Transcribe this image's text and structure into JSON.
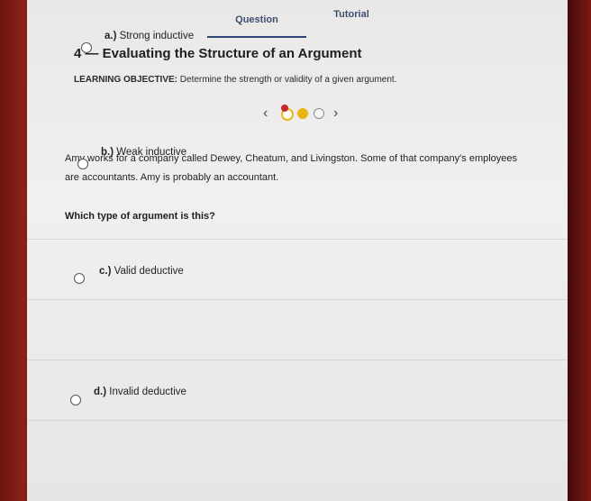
{
  "tabs": {
    "question": "Question",
    "tutorial": "Tutorial"
  },
  "lesson": {
    "title": "4 — Evaluating the Structure of an Argument",
    "objective_label": "LEARNING OBJECTIVE:",
    "objective_text": "Determine the strength or validity of a given argument."
  },
  "progress": {
    "prev": "‹",
    "next": "›"
  },
  "question": {
    "passage": "Amy works for a company called Dewey, Cheatum, and Livingston. Some of that company's employees are accountants. Amy is probably an accountant.",
    "prompt": "Which type of argument is this?"
  },
  "options": [
    {
      "letter": "a.)",
      "text": "Strong inductive"
    },
    {
      "letter": "b.)",
      "text": "Weak inductive"
    },
    {
      "letter": "c.)",
      "text": "Valid deductive"
    },
    {
      "letter": "d.)",
      "text": "Invalid deductive"
    }
  ],
  "colors": {
    "tab_text": "#3d4f73",
    "accent_yellow": "#e8b515",
    "wrong_marker": "#c42a2a",
    "bezel": "#7a1a14"
  }
}
